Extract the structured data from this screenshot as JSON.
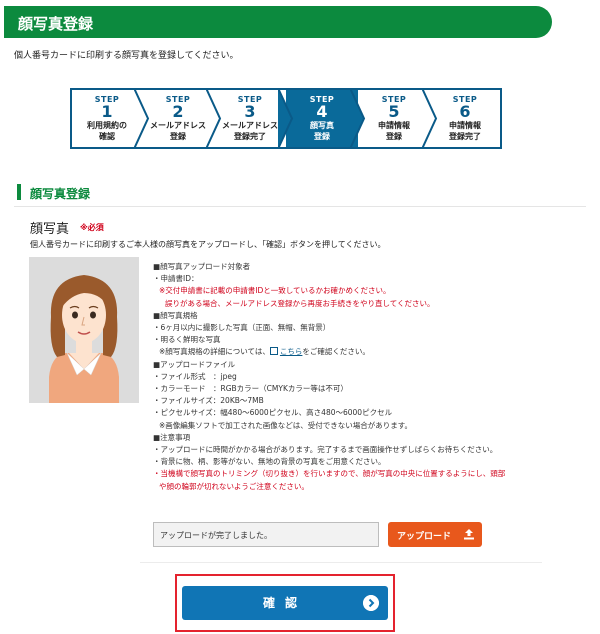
{
  "header": {
    "title": "顔写真登録"
  },
  "intro_text": "個人番号カードに印刷する顔写真を登録してください。",
  "steps": [
    {
      "label": "STEP",
      "number": "1",
      "caption_line1": "利用規約の",
      "caption_line2": "確認"
    },
    {
      "label": "STEP",
      "number": "2",
      "caption_line1": "メールアドレス",
      "caption_line2": "登録"
    },
    {
      "label": "STEP",
      "number": "3",
      "caption_line1": "メールアドレス",
      "caption_line2": "登録完了"
    },
    {
      "label": "STEP",
      "number": "4",
      "caption_line1": "顔写真",
      "caption_line2": "登録"
    },
    {
      "label": "STEP",
      "number": "5",
      "caption_line1": "申請情報",
      "caption_line2": "登録"
    },
    {
      "label": "STEP",
      "number": "6",
      "caption_line1": "申請情報",
      "caption_line2": "登録完了"
    }
  ],
  "active_step": 4,
  "section": {
    "title": "顔写真登録"
  },
  "photo": {
    "heading": "顔写真",
    "required_label": "※必須",
    "description": "個人番号カードに印刷するご本人様の顔写真をアップロードし、「確認」ボタンを押してください。"
  },
  "info": {
    "target_heading": "■顔写真アップロード対象者",
    "request_id_label": "・申請書ID：",
    "request_id_note": "※交付申請書に記載の申請書IDと一致しているかお確かめください。",
    "request_id_note2": "誤りがある場合、メールアドレス登録から再度お手続きをやり直してください。",
    "spec_heading": "■顔写真規格",
    "spec_1": "・6ヶ月以内に撮影した写真（正面、無帽、無背景）",
    "spec_2": "・明るく鮮明な写真",
    "spec_note_prefix": "※顔写真規格の詳細については、",
    "spec_link": "こちら",
    "spec_note_suffix": "をご確認ください。",
    "file_heading": "■アップロードファイル",
    "file_format": "・ファイル形式　：jpeg",
    "color_mode": "・カラーモード　：RGBカラー（CMYKカラー等は不可）",
    "file_size": "・ファイルサイズ：20KB〜7MB",
    "pixel_size": "・ピクセルサイズ：幅480〜6000ピクセル、高さ480〜6000ピクセル",
    "pixel_note": "※画像編集ソフトで加工された画像などは、受付できない場合があります。",
    "notes_heading": "■注意事項",
    "note_1": "・アップロードに時間がかかる場合があります。完了するまで画面操作せずしばらくお待ちください。",
    "note_2": "・背景に物、柄、影等がない、無地の背景の写真をご用意ください。",
    "note_3": "・当機構で顔写真のトリミング（切り抜き）を行いますので、顔が写真の中央に位置するようにし、頭部",
    "note_3b": "や顔の輪郭が切れないようご注意ください。"
  },
  "upload": {
    "status": "アップロードが完了しました。",
    "button_label": "アップロード"
  },
  "confirm": {
    "button_label": "確認"
  },
  "colors": {
    "brand_green": "#0c8a3e",
    "step_blue": "#0a6a9a",
    "upload_orange": "#e8581c",
    "confirm_blue": "#1075b5",
    "highlight_red": "#e4232e"
  },
  "icons": {
    "upload": "upload-icon",
    "confirm_arrow": "chevron-right-icon",
    "external_link": "external-link-icon"
  }
}
